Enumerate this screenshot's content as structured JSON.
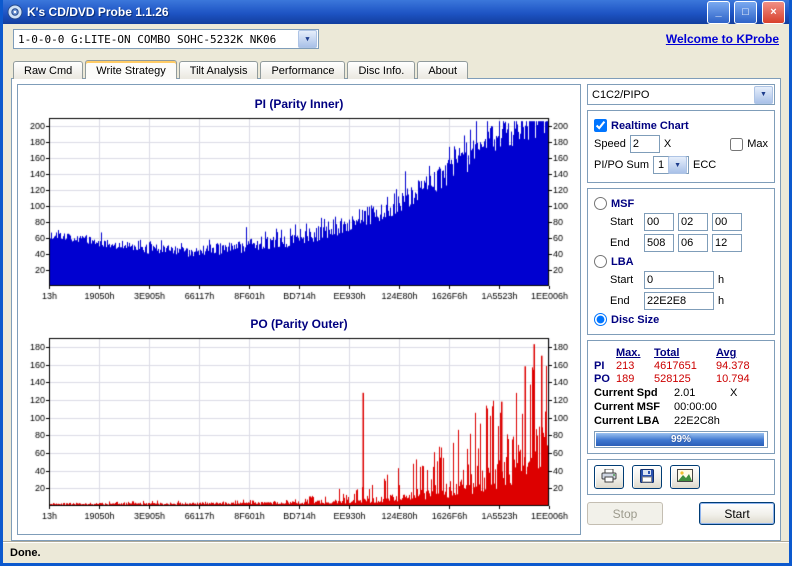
{
  "window": {
    "title": "K's CD/DVD Probe 1.1.26"
  },
  "icons": {
    "minimize": "_",
    "maximize": "□",
    "close": "×",
    "dropdown": "▼"
  },
  "toolbar": {
    "drive_selector": "1-0-0-0 G:LITE-ON COMBO SOHC-5232K NK06",
    "welcome_link": "Welcome to KProbe"
  },
  "tabs": [
    {
      "label": "Raw Cmd",
      "selected": false
    },
    {
      "label": "Write Strategy",
      "selected": true
    },
    {
      "label": "Tilt Analysis",
      "selected": false
    },
    {
      "label": "Performance",
      "selected": false
    },
    {
      "label": "Disc Info.",
      "selected": false
    },
    {
      "label": "About",
      "selected": false
    }
  ],
  "controls": {
    "mode_selector": {
      "value": "C1C2/PIPO"
    },
    "realtime": {
      "label": "Realtime Chart",
      "checked": true
    },
    "speed": {
      "label": "Speed",
      "value": "2",
      "unit": "X"
    },
    "max": {
      "label": "Max",
      "checked": false
    },
    "pipo_sum": {
      "label": "PI/PO Sum",
      "value": "1",
      "unit": "ECC"
    },
    "msf": {
      "label": "MSF",
      "checked": false,
      "start_label": "Start",
      "end_label": "End",
      "start": [
        "00",
        "02",
        "00"
      ],
      "end": [
        "508",
        "06",
        "12"
      ]
    },
    "lba": {
      "label": "LBA",
      "checked": false,
      "start_label": "Start",
      "end_label": "End",
      "start": "0",
      "end": "22E2E8",
      "unit": "h"
    },
    "disc_size": {
      "label": "Disc Size",
      "checked": true
    }
  },
  "results": {
    "headers": {
      "max": "Max.",
      "total": "Total",
      "avg": "Avg"
    },
    "pi": {
      "label": "PI",
      "max": "213",
      "total": "4617651",
      "avg": "94.378"
    },
    "po": {
      "label": "PO",
      "max": "189",
      "total": "528125",
      "avg": "10.794"
    },
    "current_spd": {
      "label": "Current Spd",
      "value": "2.01",
      "unit": "X"
    },
    "current_msf": {
      "label": "Current MSF",
      "value": "00:00:00"
    },
    "current_lba": {
      "label": "Current LBA",
      "value": "22E2C8h"
    },
    "progress": {
      "percent": 99,
      "label": "99%"
    }
  },
  "actions": {
    "stop": "Stop",
    "start": "Start"
  },
  "status": "Done.",
  "colors": {
    "accent": "#000080",
    "value_red": "#CC0000",
    "pi_fill": "#0000D0",
    "po_fill": "#DD0000"
  },
  "chart_data": [
    {
      "type": "area",
      "title": "PI (Parity Inner)",
      "color": "#0000D0",
      "ylim": [
        0,
        210
      ],
      "yticks": [
        20,
        40,
        60,
        80,
        100,
        120,
        140,
        160,
        180,
        200
      ],
      "x_labels": [
        "13h",
        "19050h",
        "3E905h",
        "66117h",
        "8F601h",
        "BD714h",
        "EE930h",
        "124E80h",
        "1626F6h",
        "1A5523h",
        "1EE006h"
      ],
      "envelope": {
        "x": [
          0,
          0.04,
          0.08,
          0.13,
          0.18,
          0.23,
          0.28,
          0.33,
          0.38,
          0.44,
          0.5,
          0.55,
          0.6,
          0.65,
          0.7,
          0.75,
          0.8,
          0.85,
          0.9,
          0.94,
          1.0
        ],
        "v": [
          63,
          60,
          56,
          51,
          47,
          44,
          43,
          45,
          48,
          53,
          60,
          68,
          78,
          90,
          104,
          122,
          142,
          163,
          183,
          196,
          204
        ]
      },
      "noise": {
        "kind": "pi",
        "j0": 9,
        "j1": 40
      },
      "clip": 206,
      "floor": 2,
      "seed": 1234,
      "grid": true,
      "special": []
    },
    {
      "type": "area",
      "title": "PO (Parity Outer)",
      "color": "#DD0000",
      "ylim": [
        0,
        190
      ],
      "yticks": [
        20,
        40,
        60,
        80,
        100,
        120,
        140,
        160,
        180
      ],
      "x_labels": [
        "13h",
        "19050h",
        "3E905h",
        "66117h",
        "8F601h",
        "BD714h",
        "EE930h",
        "124E80h",
        "1626F6h",
        "1A5523h",
        "1EE006h"
      ],
      "envelope": {
        "x": [
          0,
          0.3,
          0.45,
          0.55,
          0.62,
          0.68,
          0.74,
          0.8,
          0.85,
          0.9,
          0.94,
          0.97,
          1.0
        ],
        "v": [
          2.5,
          3,
          3.5,
          4.5,
          6,
          9,
          13,
          19,
          27,
          38,
          50,
          62,
          72
        ]
      },
      "noise": {
        "kind": "po",
        "p0": 0.08,
        "p1": 0.3,
        "pivot": 0.42,
        "scale": 430,
        "base": 3
      },
      "clip": 186,
      "floor": 0.8,
      "seed": 98765,
      "grid": true,
      "special": [
        {
          "f": 0.628,
          "v": 128
        },
        {
          "f": 0.905,
          "v": 118
        },
        {
          "f": 0.952,
          "v": 158
        },
        {
          "f": 0.97,
          "v": 183
        },
        {
          "f": 0.985,
          "v": 170
        }
      ]
    }
  ]
}
